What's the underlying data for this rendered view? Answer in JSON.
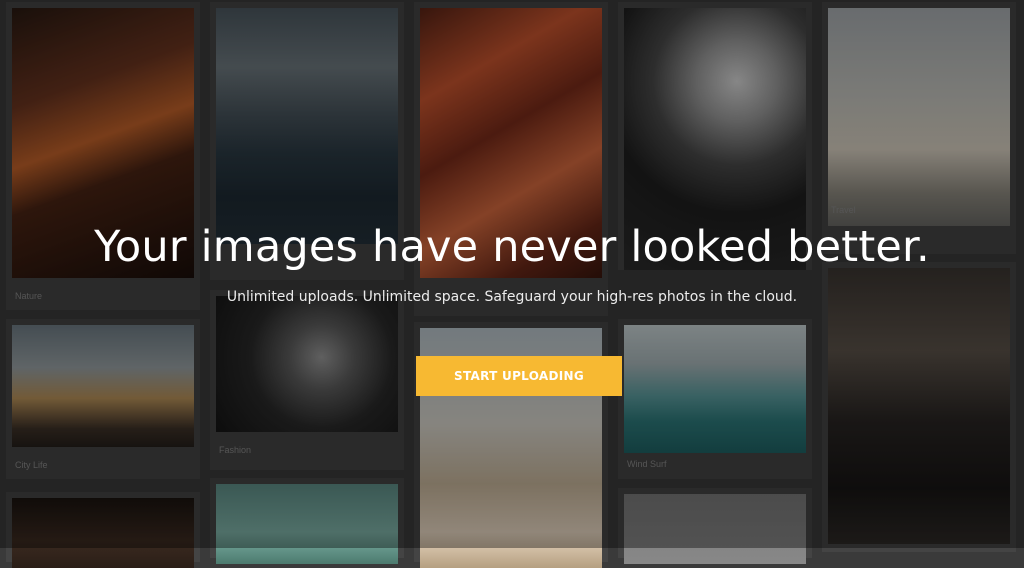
{
  "hero": {
    "title": "Your images have never looked better.",
    "subtitle": "Unlimited uploads. Unlimited space. Safeguard your high-res photos in the cloud.",
    "cta_label": "START UPLOADING"
  },
  "gallery": {
    "captions": {
      "nature": "Nature",
      "travel": "Travel",
      "city_life": "City Life",
      "fashion": "Fashion",
      "wind_surf": "Wind Surf"
    }
  },
  "colors": {
    "accent": "#f7b932",
    "card_bg": "#444444",
    "page_bg": "#3a3a3a"
  }
}
